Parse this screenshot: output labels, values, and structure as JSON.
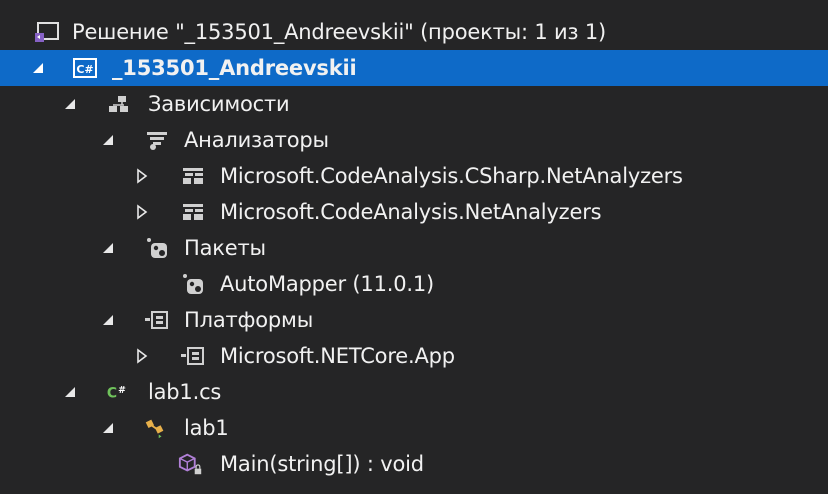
{
  "tree": {
    "solution": "Решение \"_153501_Andreevskii\" (проекты: 1 из 1)",
    "project": "_153501_Andreevskii",
    "dependencies": "Зависимости",
    "analyzers": "Анализаторы",
    "analyzer_csharp": "Microsoft.CodeAnalysis.CSharp.NetAnalyzers",
    "analyzer_net": "Microsoft.CodeAnalysis.NetAnalyzers",
    "packages": "Пакеты",
    "automapper": "AutoMapper (11.0.1)",
    "frameworks": "Платформы",
    "netcore": "Microsoft.NETCore.App",
    "file": "lab1.cs",
    "class": "lab1",
    "method": "Main(string[]) : void"
  },
  "icons": {
    "solution": "visual-studio-solution-icon",
    "project": "csharp-project-icon",
    "dependencies": "dependencies-icon",
    "analyzers": "analyzer-icon",
    "package": "nuget-package-icon",
    "framework": "framework-icon",
    "csharp_file": "csharp-file-icon",
    "class": "class-icon",
    "method": "method-icon"
  },
  "colors": {
    "background": "#252526",
    "selection": "#0e6ac8",
    "text": "#f1f1f1",
    "csharp_green": "#6fc25b",
    "method_purple": "#b180d7",
    "class_orange": "#e8b04a"
  }
}
